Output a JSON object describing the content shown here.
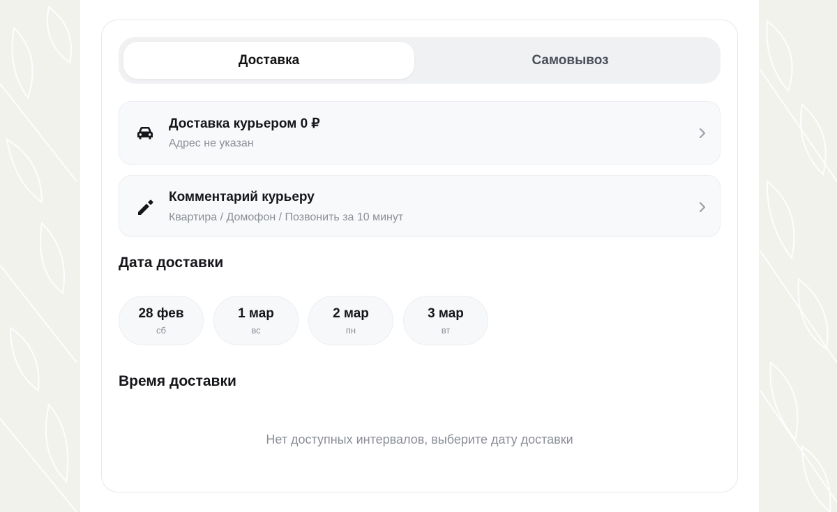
{
  "tabs": {
    "delivery": "Доставка",
    "pickup": "Самовывоз"
  },
  "courier": {
    "title": "Доставка курьером 0 ₽",
    "subtitle": "Адрес не указан",
    "icon": "car-icon"
  },
  "comment": {
    "title": "Комментарий курьеру",
    "subtitle": "Квартира / Домофон / Позвонить за 10 минут",
    "icon": "pencil-icon"
  },
  "delivery_date": {
    "title": "Дата доставки",
    "dates": [
      {
        "day": "28 фев",
        "weekday": "сб"
      },
      {
        "day": "1 мар",
        "weekday": "вс"
      },
      {
        "day": "2 мар",
        "weekday": "пн"
      },
      {
        "day": "3 мар",
        "weekday": "вт"
      }
    ]
  },
  "delivery_time": {
    "title": "Время доставки",
    "empty_message": "Нет доступных интервалов, выберите дату доставки"
  },
  "colors": {
    "background": "#f2f2ec",
    "card": "#ffffff",
    "tab_track": "#f0f1f3",
    "row_bg": "#f8f9fb",
    "text_primary": "#15161a",
    "text_secondary": "#8a8e96"
  }
}
